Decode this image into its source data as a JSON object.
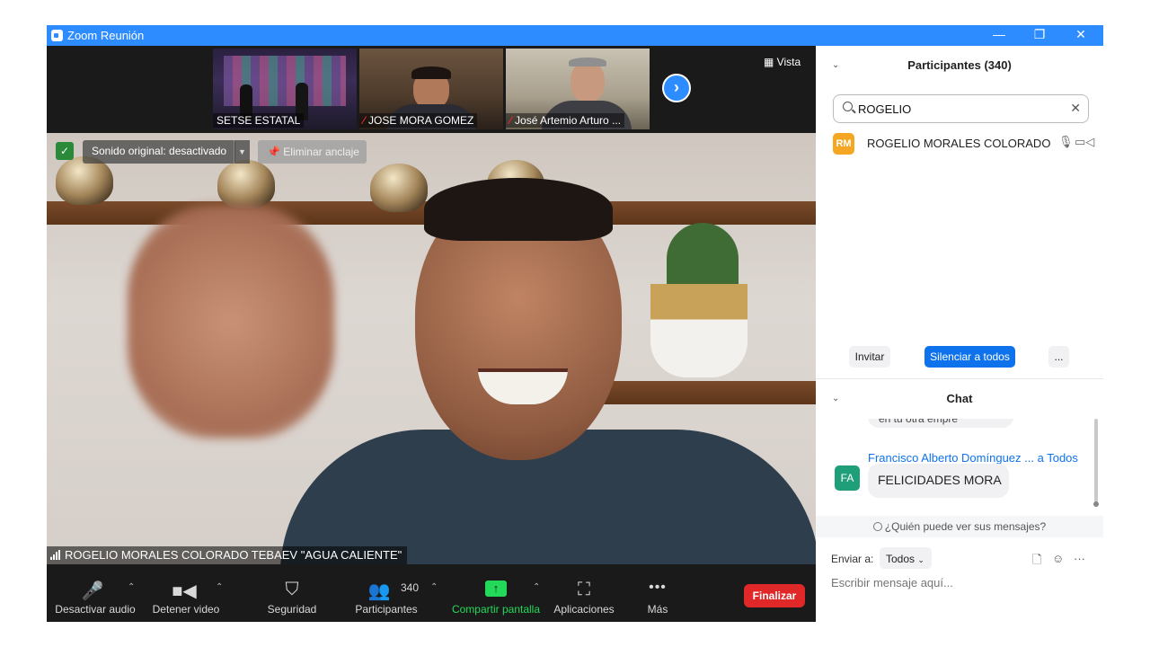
{
  "window": {
    "title": "Zoom Reunión",
    "minimize": "—",
    "restore": "❐",
    "close": "✕"
  },
  "thumbnails": [
    {
      "name": "SETSE ESTATAL",
      "muted": false
    },
    {
      "name": "JOSE MORA GOMEZ",
      "muted": true
    },
    {
      "name": "José Artemio Arturo ...",
      "muted": true
    }
  ],
  "view_button": "Vista",
  "main_video": {
    "sound_original": "Sonido original: desactivado",
    "unpin": "Eliminar anclaje",
    "speaker_name": "ROGELIO MORALES COLORADO TEBAEV \"AGUA CALIENTE\""
  },
  "toolbar": {
    "audio": "Desactivar audio",
    "video": "Detener video",
    "security": "Seguridad",
    "participants": "Participantes",
    "participants_count": "340",
    "share": "Compartir pantalla",
    "apps": "Aplicaciones",
    "more": "Más",
    "end": "Finalizar"
  },
  "participants_panel": {
    "title": "Participantes (340)",
    "search_value": "ROGELIO",
    "result": {
      "initials": "RM",
      "name": "ROGELIO MORALES COLORADO ...",
      "color": "#f5a623"
    },
    "invite": "Invitar",
    "mute_all": "Silenciar a todos",
    "more": "..."
  },
  "chat_panel": {
    "title": "Chat",
    "cut_message": "en tu otra empre",
    "message": {
      "initials": "FA",
      "avatar_color": "#1f9e7a",
      "sender": "Francisco Alberto Domínguez ...",
      "to": "a Todos",
      "text": "FELICIDADES MORA"
    },
    "who_sees": "¿Quién puede ver sus mensajes?",
    "send_to_label": "Enviar a:",
    "send_to_value": "Todos",
    "placeholder": "Escribir mensaje aquí..."
  },
  "colors": {
    "zoom_blue": "#2d8cff",
    "end_red": "#e02828",
    "share_green": "#23d959"
  }
}
